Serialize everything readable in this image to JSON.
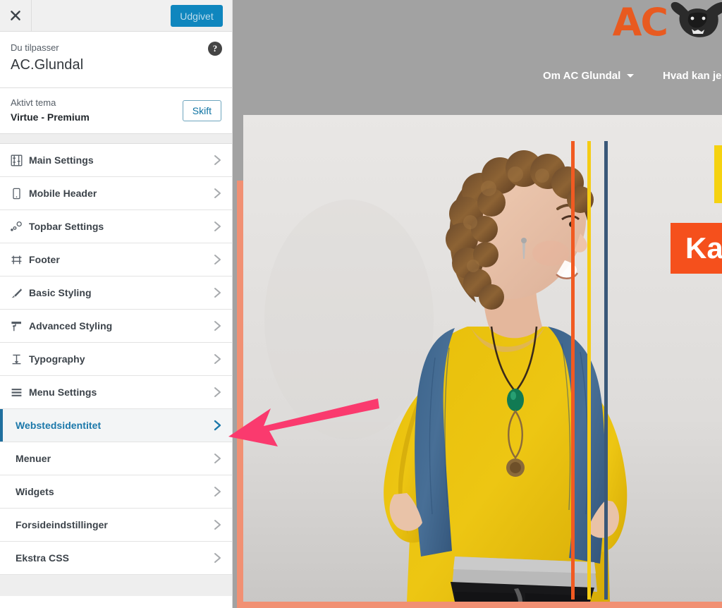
{
  "customizer": {
    "close_icon": "close-x-icon",
    "publish_label": "Udgivet",
    "help_icon": "help-question-icon",
    "customizing_label": "Du tilpasser",
    "site_title": "AC.Glundal",
    "active_theme_label": "Aktivt tema",
    "active_theme_name": "Virtue - Premium",
    "switch_label": "Skift",
    "accent_blue": "#0f86be",
    "active_item_blue": "#1b78aa",
    "panels": [
      {
        "label": "Main Settings",
        "icon": "sliders-icon",
        "has_icon": true,
        "active": false
      },
      {
        "label": "Mobile Header",
        "icon": "mobile-phone-icon",
        "has_icon": true,
        "active": false
      },
      {
        "label": "Topbar Settings",
        "icon": "topbar-nodes-icon",
        "has_icon": true,
        "active": false
      },
      {
        "label": "Footer",
        "icon": "footer-stool-icon",
        "has_icon": true,
        "active": false
      },
      {
        "label": "Basic Styling",
        "icon": "paint-brush-icon",
        "has_icon": true,
        "active": false
      },
      {
        "label": "Advanced Styling",
        "icon": "paint-roller-icon",
        "has_icon": true,
        "active": false
      },
      {
        "label": "Typography",
        "icon": "typography-t-icon",
        "has_icon": true,
        "active": false
      },
      {
        "label": "Menu Settings",
        "icon": "hamburger-menu-icon",
        "has_icon": true,
        "active": false
      },
      {
        "label": "Webstedsidentitet",
        "icon": "",
        "has_icon": false,
        "active": true
      },
      {
        "label": "Menuer",
        "icon": "",
        "has_icon": false,
        "active": false
      },
      {
        "label": "Widgets",
        "icon": "",
        "has_icon": false,
        "active": false
      },
      {
        "label": "Forsideindstillinger",
        "icon": "",
        "has_icon": false,
        "active": false
      },
      {
        "label": "Ekstra CSS",
        "icon": "",
        "has_icon": false,
        "active": false
      }
    ]
  },
  "preview": {
    "background_color": "#a2a2a2",
    "nav": [
      {
        "label": "Om AC Glundal",
        "has_caret": true
      },
      {
        "label": "Hvad kan je",
        "has_caret": false
      }
    ],
    "logo": {
      "text": "AC",
      "text_color": "#e85a20",
      "mark": "buffalo-head-icon"
    },
    "hero": {
      "photo_alt": "woman-portrait-photo",
      "accent_edge_color": "#f19073",
      "stripes": [
        {
          "color": "#f15a22"
        },
        {
          "color": "#f5cc14"
        },
        {
          "color": "#3a5878"
        }
      ],
      "yellow_block_color": "#f5d210",
      "orange_block_color": "#f5501c",
      "orange_block_text": "Kan"
    }
  },
  "annotation": {
    "arrow_color": "#fa3a6e",
    "arrow_direction": "left",
    "points_at": "Webstedsidentitet"
  }
}
